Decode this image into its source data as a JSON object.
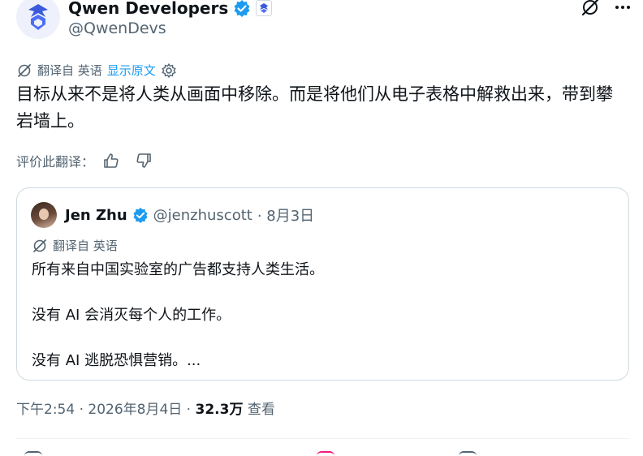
{
  "account": {
    "display_name": "Qwen Developers",
    "handle": "@QwenDevs"
  },
  "translation": {
    "translated_from": "翻译自 英语",
    "show_original": "显示原文"
  },
  "tweet": {
    "text": "目标从来不是将人类从画面中移除。而是将他们从电子表格中解救出来，带到攀岩墙上。"
  },
  "rate_translation": {
    "label": "评价此翻译："
  },
  "quoted_tweet": {
    "author_name": "Jen Zhu",
    "author_handle": "@jenzhuscott",
    "date": "· 8月3日",
    "translated_from": "翻译自 英语",
    "paragraphs": [
      "所有来自中国实验室的广告都支持人类生活。",
      "没有 AI 会消灭每个人的工作。",
      "没有 AI 逃脱恐惧营销。..."
    ]
  },
  "meta": {
    "time_date": "下午2:54 · 2026年8月4日 · ",
    "views_count": "32.3万",
    "views_label": " 查看"
  },
  "colors": {
    "accent": "#1d9bf0",
    "muted_text": "#536471",
    "primary_text": "#0f1419",
    "border": "#cfd9de",
    "verified_gold": "#1d9bf0"
  },
  "icons": {
    "avatar": "qwen-logo-icon",
    "verified": "verified-badge-icon",
    "affiliate": "affiliate-badge-icon",
    "grok": "grok-icon",
    "more": "more-icon",
    "translate": "translate-icon",
    "settings": "gear-icon",
    "thumbs_up": "thumbs-up-icon",
    "thumbs_down": "thumbs-down-icon"
  }
}
